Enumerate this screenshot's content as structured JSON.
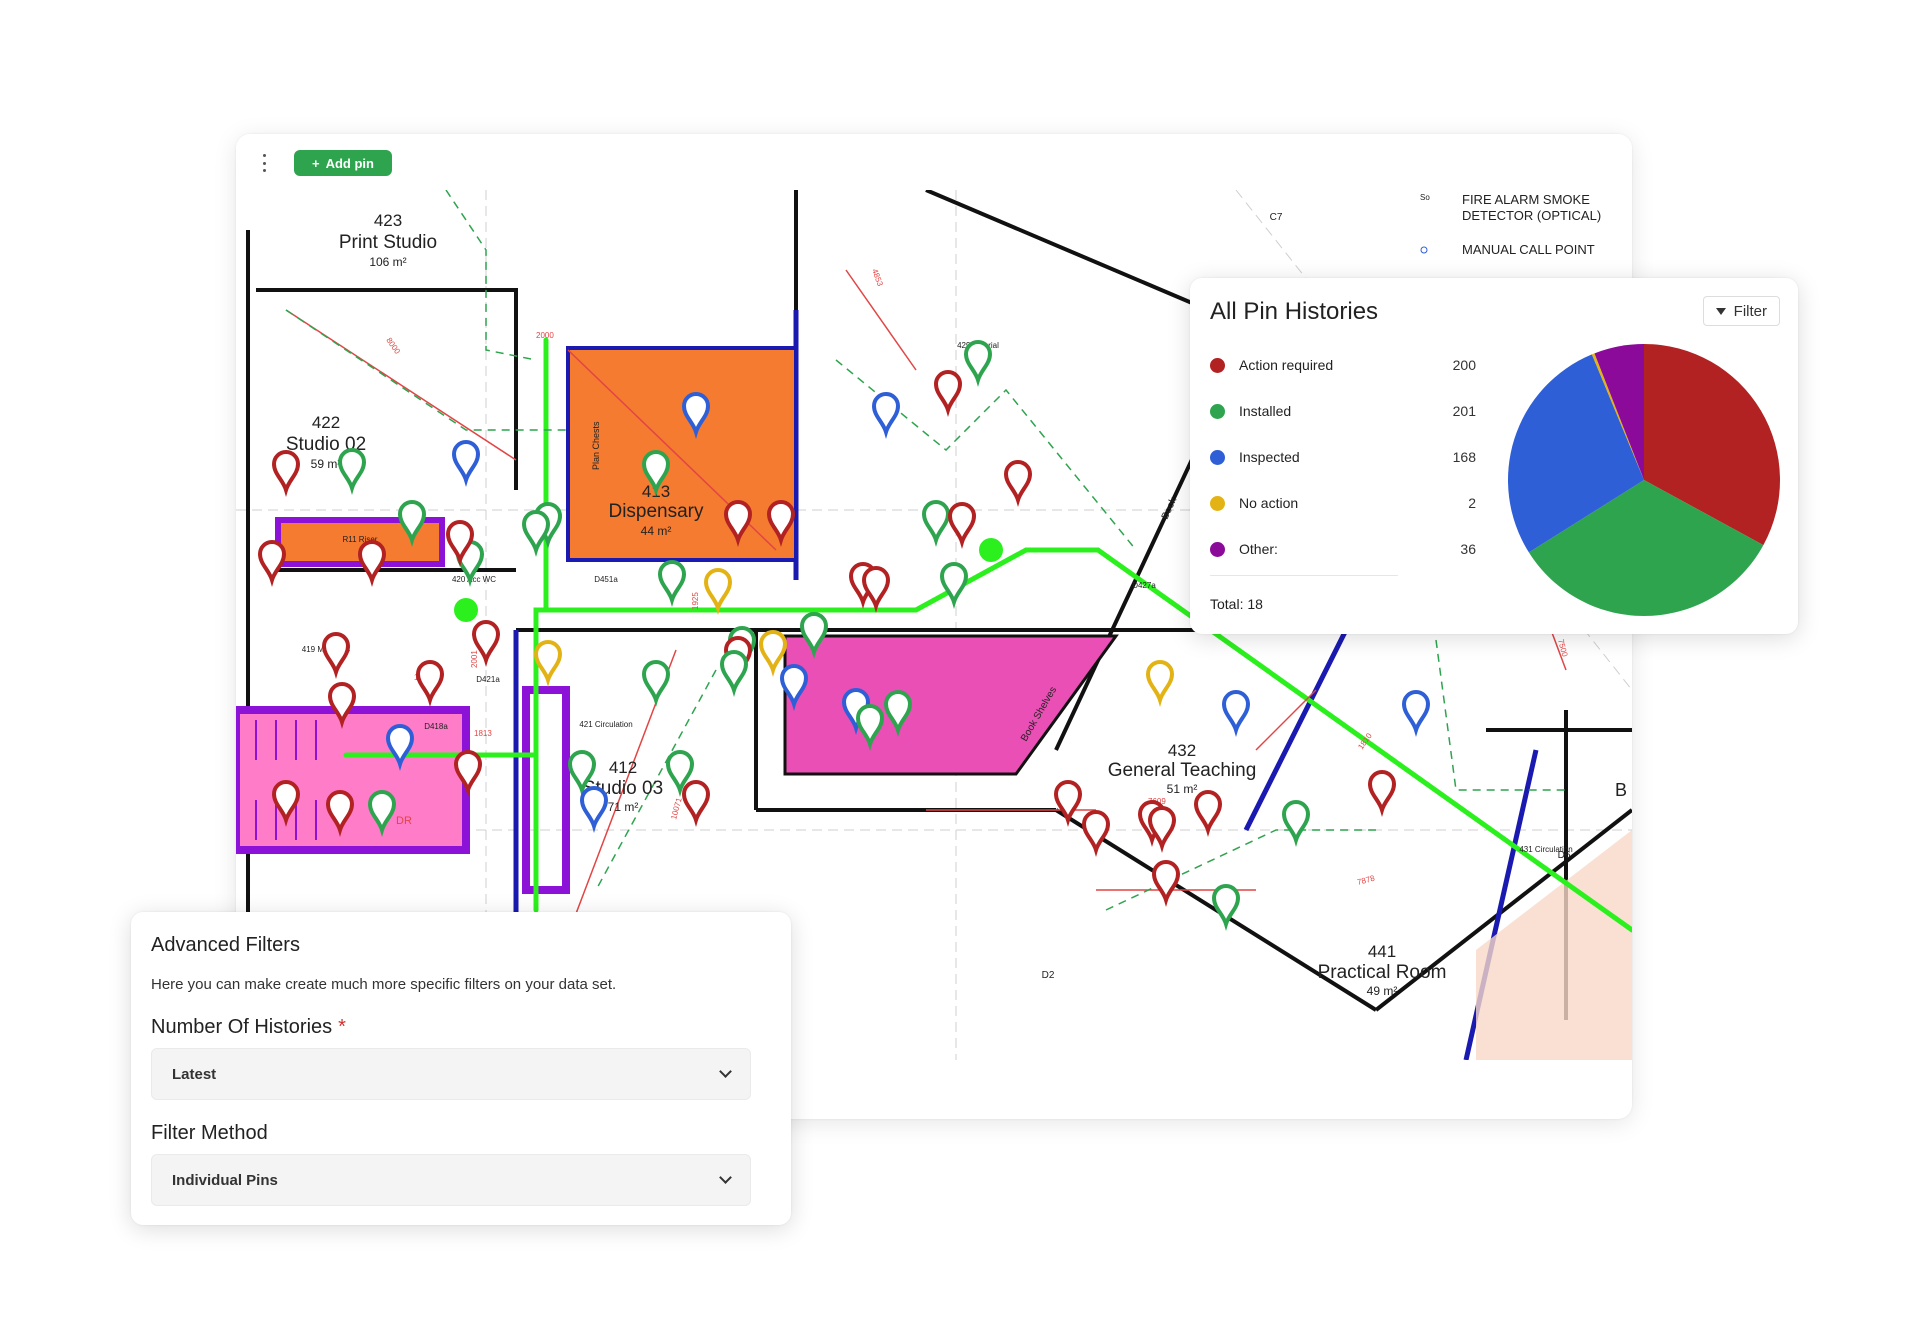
{
  "toolbar": {
    "add_pin_label": "Add pin",
    "add_pin_icon": "+"
  },
  "plan": {
    "rooms": [
      {
        "number": "423",
        "name": "Print Studio",
        "area": "106 m²"
      },
      {
        "number": "422",
        "name": "Studio 02",
        "area": "59 m²"
      },
      {
        "number": "413",
        "name": "Dispensary",
        "area": "44 m²"
      },
      {
        "number": "412",
        "name": "Studio 03",
        "area": "71 m²"
      },
      {
        "number": "432",
        "name": "General Teaching",
        "area": "51 m²"
      },
      {
        "number": "441",
        "name": "Practical Room",
        "area": "49 m²"
      }
    ],
    "small_labels": {
      "plan_chests": "Plan Chests",
      "book_shelves": "Book Shelves",
      "book": "Book",
      "riser": "R11 Riser",
      "male_wc": "419 Male WC",
      "acc_wc": "420 Acc WC",
      "circulation_421": "421 Circulation",
      "circulation_431": "431 Circulation",
      "tutorial": "429 Tutorial",
      "dr": "DR",
      "b": "B",
      "dim_2000": "2000",
      "dim_1900": "1900",
      "dim_1925": "1925",
      "dim_2001": "2001",
      "dim_1685": "1685",
      "dim_1813": "1813",
      "dim_10071": "10071",
      "dim_7609": "7609",
      "dim_7878": "7878",
      "dim_1810": "1810",
      "dim_7500": "7500",
      "dim_4853": "4853",
      "dim_8000": "8000",
      "d451a": "D451a",
      "d421a": "D421a",
      "d418a": "D418a",
      "d427a": "D427a",
      "c7": "C7",
      "d2": "D2",
      "d6": "D6"
    },
    "key": {
      "smoke_symbol": "So",
      "smoke_label_1": "FIRE ALARM SMOKE",
      "smoke_label_2": "DETECTOR (OPTICAL)",
      "call_point_label": "MANUAL CALL POINT"
    },
    "pin_colors": {
      "action_required": "#b22222",
      "installed": "#2ea44f",
      "inspected": "#2f5fd6",
      "no_action": "#e3b316"
    }
  },
  "history": {
    "title": "All Pin Histories",
    "filter_label": "Filter",
    "total_label": "Total: 18",
    "legend": [
      {
        "label": "Action required",
        "count": "200",
        "color": "#b22222"
      },
      {
        "label": "Installed",
        "count": "201",
        "color": "#2ea44f"
      },
      {
        "label": "Inspected",
        "count": "168",
        "color": "#2f5fd6"
      },
      {
        "label": "No action",
        "count": "2",
        "color": "#e3b316"
      },
      {
        "label": "Other:",
        "count": "36",
        "color": "#8b0a9a"
      }
    ]
  },
  "chart_data": {
    "type": "pie",
    "categories": [
      "Action required",
      "Installed",
      "Inspected",
      "No action",
      "Other:"
    ],
    "values": [
      200,
      201,
      168,
      2,
      36
    ],
    "colors": [
      "#b22222",
      "#2ea44f",
      "#2f5fd6",
      "#e3b316",
      "#8b0a9a"
    ],
    "title": "All Pin Histories"
  },
  "filters": {
    "title": "Advanced Filters",
    "description": "Here you can make create much more specific filters on your data set.",
    "histories_label": "Number Of Histories",
    "histories_required": "*",
    "histories_value": "Latest",
    "method_label": "Filter Method",
    "method_value": "Individual Pins"
  }
}
